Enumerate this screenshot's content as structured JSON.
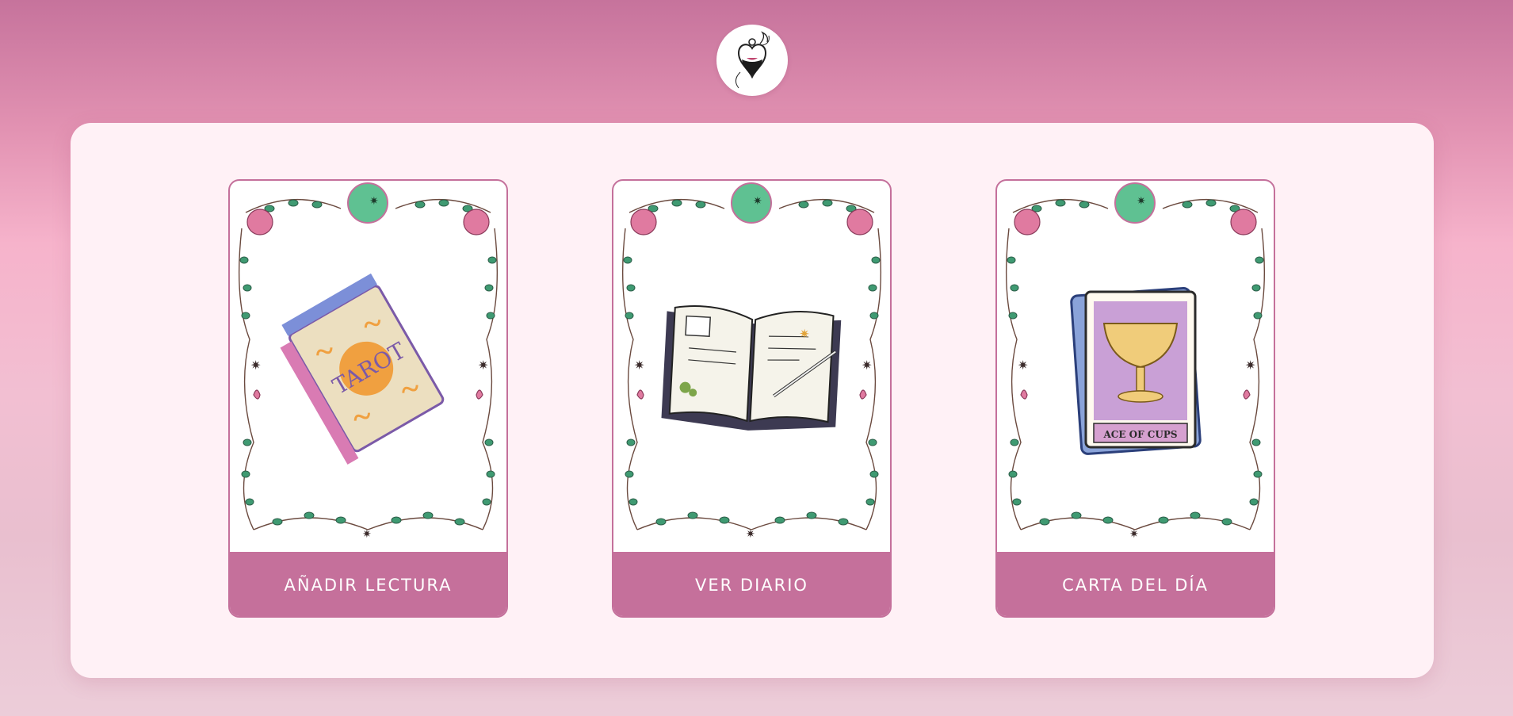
{
  "header": {
    "logo_icon": "potion-heart-icon"
  },
  "colors": {
    "card_footer": "#c5709b",
    "panel_bg": "#fff1f6",
    "leaf_green": "#3f9a72",
    "rose_pink": "#e07aa0"
  },
  "cards": [
    {
      "label": "AÑADIR LECTURA",
      "icon": "tarot-deck-icon"
    },
    {
      "label": "VER DIARIO",
      "icon": "journal-icon"
    },
    {
      "label": "CARTA DEL DÍA",
      "icon": "ace-of-cups-card-icon"
    }
  ],
  "tarot_icon": {
    "deck_text": "TAROT"
  },
  "card_icon": {
    "card_text": "ACE OF CUPS"
  }
}
